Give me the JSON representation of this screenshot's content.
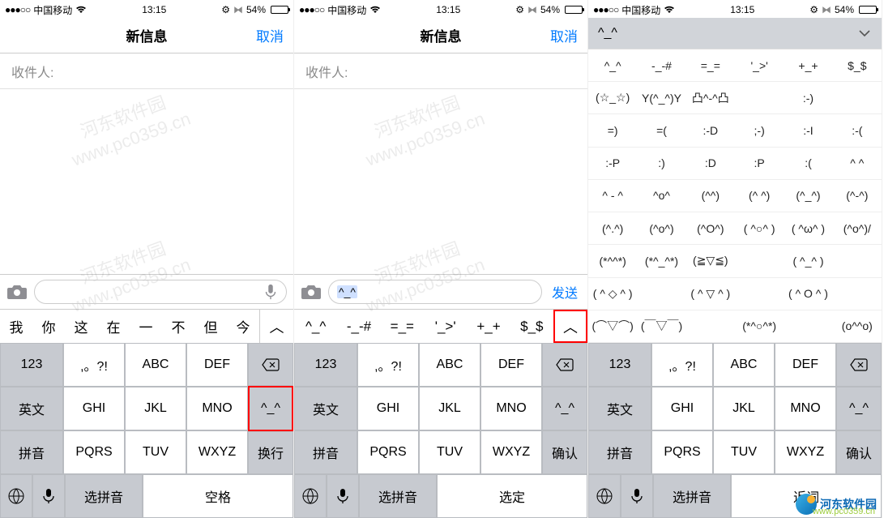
{
  "status": {
    "signal": "●●●○○",
    "carrier": "中国移动",
    "time": "13:15",
    "bt_pct": "54%"
  },
  "nav": {
    "title": "新信息",
    "cancel": "取消"
  },
  "recipient": {
    "label": "收件人:"
  },
  "watermark": {
    "line1": "河东软件园",
    "line2": "www.pc0359.cn"
  },
  "send_label": "发送",
  "input2_text": "^_^",
  "screen3_selected": "^_^",
  "cand1": [
    "我",
    "你",
    "这",
    "在",
    "一",
    "不",
    "但",
    "今"
  ],
  "cand2": [
    "^_^",
    "-_-#",
    "=_=",
    "'_>'",
    "+_+",
    "$_$"
  ],
  "kaomoji_rows": [
    [
      "^_^",
      "-_-#",
      "=_=",
      "'_>'",
      "+_+",
      "$_$"
    ],
    [
      "(☆_☆)",
      "Y(^_^)Y",
      "凸^-^凸",
      "",
      ":-)",
      ""
    ],
    [
      "=)",
      "=(",
      ":-D",
      ";-)",
      ":-I",
      ":-("
    ],
    [
      ":-P",
      ":)",
      ":D",
      ":P",
      ":(",
      "^ ^"
    ],
    [
      "^ - ^",
      "^o^",
      "(^^)",
      "(^ ^)",
      "(^_^)",
      "(^-^)"
    ],
    [
      "(^.^)",
      "(^o^)",
      "(^O^)",
      "( ^○^ )",
      "( ^ω^ )",
      "(^o^)/"
    ],
    [
      "(*^^*)",
      "(*^_^*)",
      "(≧▽≦)",
      "",
      "( ^_^ )",
      ""
    ],
    [
      "( ^ ◇ ^ )",
      "",
      "( ^ ▽ ^ )",
      "",
      "( ^ O ^ )",
      ""
    ],
    [
      "(⌒▽⌒)",
      "(￣▽￣)",
      "",
      "(*^○^*)",
      "",
      "(o^^o)"
    ]
  ],
  "keys": {
    "num": "123",
    "punct": ",。?!",
    "abc": "ABC",
    "def": "DEF",
    "ghi": "GHI",
    "jkl": "JKL",
    "mno": "MNO",
    "pqrs": "PQRS",
    "tuv": "TUV",
    "wxyz": "WXYZ",
    "en": "英文",
    "py": "拼音",
    "face": "^_^",
    "newline": "换行",
    "confirm": "确认",
    "select": "选定",
    "recent": "近词",
    "selpy": "选拼音",
    "space": "空格"
  },
  "footer": {
    "brand": "河东软件园",
    "url": "www.pc0359.cn"
  }
}
